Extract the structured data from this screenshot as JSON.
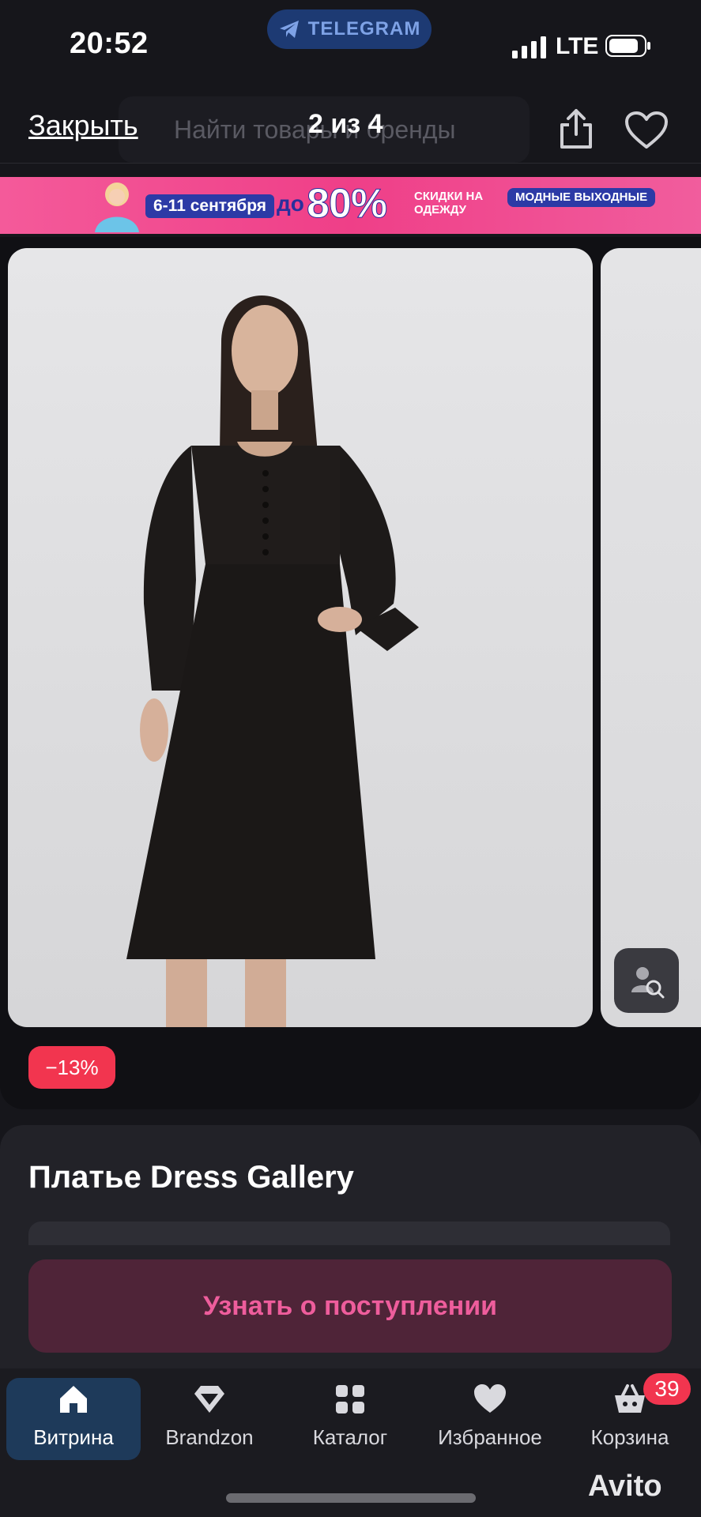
{
  "status_bar": {
    "time": "20:52",
    "telegram_label": "TELEGRAM",
    "network": "LTE"
  },
  "top_bar": {
    "close_label": "Закрыть",
    "search_placeholder": "Найти товары и бренды",
    "page_counter": "2 из 4",
    "share_icon": "share-icon",
    "favorite_icon": "heart-icon"
  },
  "promo_banner": {
    "dates": "6-11 сентября",
    "up_to": "до",
    "percent": "80%",
    "discount_text": "СКИДКИ НА ОДЕЖДУ",
    "fashion_label": "МОДНЫЕ ВЫХОДНЫЕ"
  },
  "gallery": {
    "discount_badge": "−13%",
    "visual_search_icon": "visual-search-icon"
  },
  "product": {
    "title": "Платье Dress Gallery",
    "notify_button": "Узнать о поступлении"
  },
  "bottom_nav": {
    "items": [
      {
        "label": "Витрина",
        "icon": "home-icon"
      },
      {
        "label": "Brandzon",
        "icon": "diamond-icon"
      },
      {
        "label": "Каталог",
        "icon": "grid-icon"
      },
      {
        "label": "Избранное",
        "icon": "heart-icon"
      },
      {
        "label": "Корзина",
        "icon": "basket-icon"
      }
    ],
    "cart_count": "39"
  },
  "watermark": "Avito",
  "colors": {
    "accent_pink": "#ee5d9c",
    "badge_red": "#f2354f",
    "nav_active": "#1e3a5a"
  }
}
